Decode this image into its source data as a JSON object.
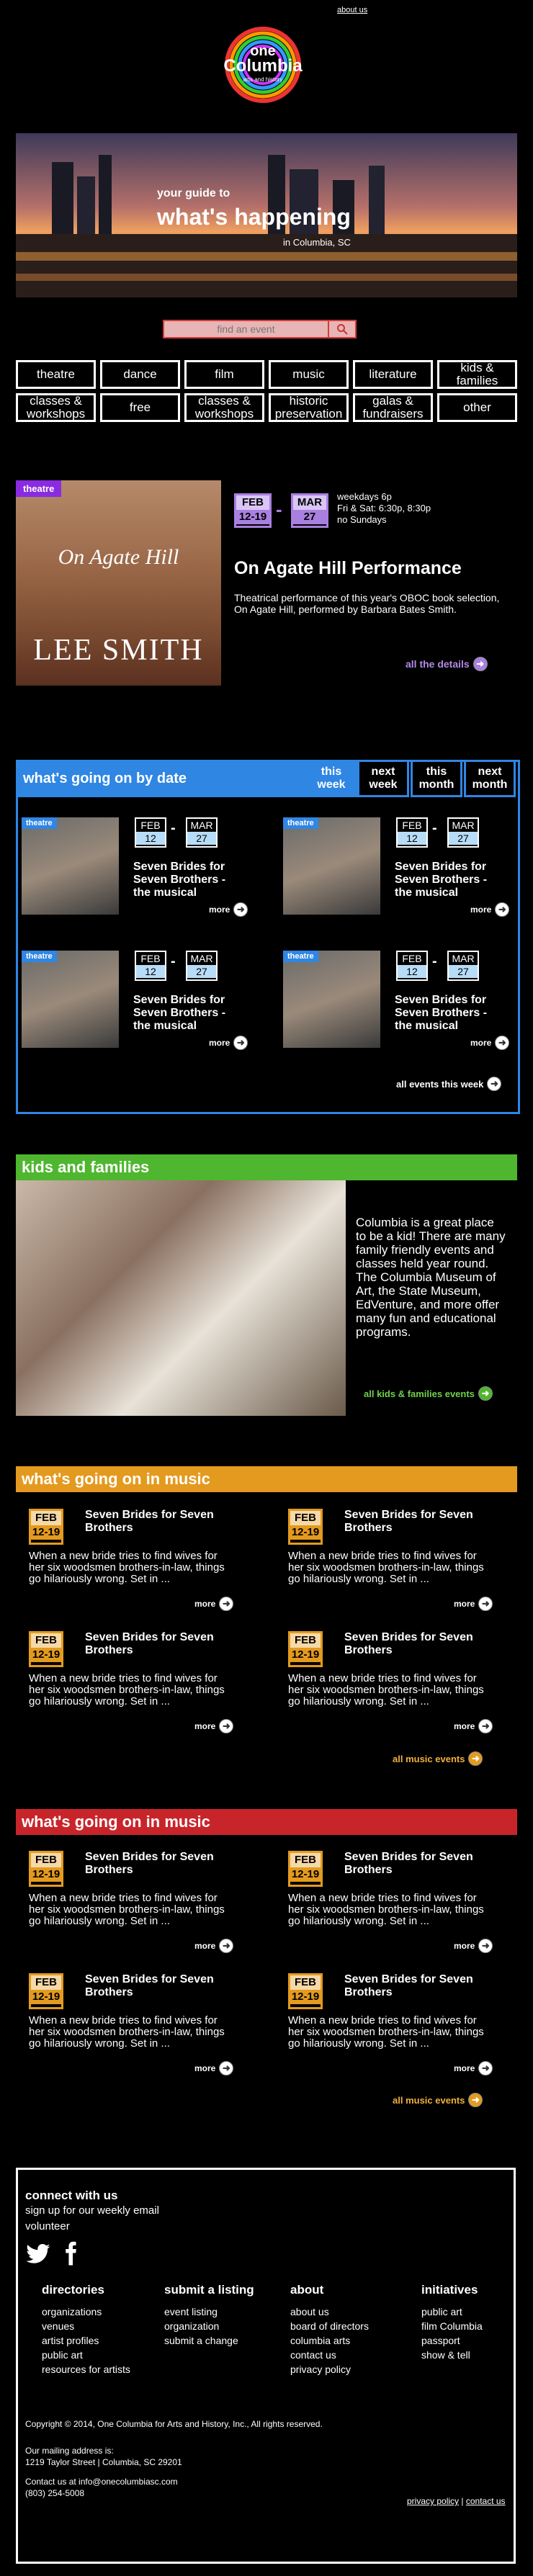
{
  "topnav": {
    "about": "about us"
  },
  "logo": {
    "line1": "one",
    "line2": "Columbia",
    "line3": "arts and history"
  },
  "hero": {
    "line1": "your guide to",
    "line2": "what's happening",
    "line3": "in Columbia, SC"
  },
  "search": {
    "placeholder": "find an event"
  },
  "categories": [
    "theatre",
    "dance",
    "film",
    "music",
    "literature",
    "kids & families",
    "classes & workshops",
    "free",
    "classes & workshops",
    "historic preservation",
    "galas & fundraisers",
    "other"
  ],
  "featured": {
    "tag": "theatre",
    "book_title": "On Agate Hill",
    "book_author": "LEE SMITH",
    "start_month": "FEB",
    "start_day": "12-19",
    "end_month": "MAR",
    "end_day": "27",
    "schedule": [
      "weekdays 6p",
      "Fri & Sat: 6:30p, 8:30p",
      "no Sundays"
    ],
    "title": "On Agate Hill Performance",
    "description": "Theatrical performance of this year's OBOC book selection, On Agate Hill, performed by Barbara Bates Smith.",
    "link": "all the details",
    "colors": {
      "tag": "#8a2be2",
      "date": "#a97fe0"
    }
  },
  "by_date": {
    "heading": "what's going on by date",
    "tabs": [
      "this week",
      "next week",
      "this month",
      "next month"
    ],
    "events": [
      {
        "tag": "theatre",
        "start_month": "FEB",
        "start_day": "12",
        "end_month": "MAR",
        "end_day": "27",
        "title": "Seven Brides for Seven Brothers - the musical",
        "more": "more"
      },
      {
        "tag": "theatre",
        "start_month": "FEB",
        "start_day": "12",
        "end_month": "MAR",
        "end_day": "27",
        "title": "Seven Brides for Seven Brothers - the musical",
        "more": "more"
      },
      {
        "tag": "theatre",
        "start_month": "FEB",
        "start_day": "12",
        "end_month": "MAR",
        "end_day": "27",
        "title": "Seven Brides for Seven Brothers - the musical",
        "more": "more"
      },
      {
        "tag": "theatre",
        "start_month": "FEB",
        "start_day": "12",
        "end_month": "MAR",
        "end_day": "27",
        "title": "Seven Brides for Seven Brothers - the musical",
        "more": "more"
      }
    ],
    "all_link": "all events this week",
    "color": "#2f86e3"
  },
  "kids": {
    "heading": "kids and families",
    "text": "Columbia is a great place to be a kid!  There are many family friendly events and classes held year round.  The Columbia Museum of Art, the State Museum, EdVenture, and more offer many fun and educational programs.",
    "link": "all kids & families events",
    "color": "#4fb62f"
  },
  "music1": {
    "heading": "what's going on in music",
    "color": "#e39a1e",
    "events": [
      {
        "month": "FEB",
        "day": "12-19",
        "title": "Seven Brides for Seven Brothers",
        "desc": "When a new bride tries to find wives for her six woodsmen brothers-in-law, things go hilariously wrong. Set in ...",
        "more": "more"
      },
      {
        "month": "FEB",
        "day": "12-19",
        "title": "Seven Brides for Seven Brothers",
        "desc": "When a new bride tries to find wives for her six woodsmen brothers-in-law, things go hilariously wrong. Set in ...",
        "more": "more"
      },
      {
        "month": "FEB",
        "day": "12-19",
        "title": "Seven Brides for Seven Brothers",
        "desc": "When a new bride tries to find wives for her six woodsmen brothers-in-law, things go hilariously wrong. Set in ...",
        "more": "more"
      },
      {
        "month": "FEB",
        "day": "12-19",
        "title": "Seven Brides for Seven Brothers",
        "desc": "When a new bride tries to find wives for her six woodsmen brothers-in-law, things go hilariously wrong. Set in ...",
        "more": "more"
      }
    ],
    "all_link": "all music events"
  },
  "music2": {
    "heading": "what's going on in music",
    "color": "#c8252b",
    "events": [
      {
        "month": "FEB",
        "day": "12-19",
        "title": "Seven Brides for Seven Brothers",
        "desc": "When a new bride tries to find wives for her six woodsmen brothers-in-law, things go hilariously wrong. Set in ...",
        "more": "more"
      },
      {
        "month": "FEB",
        "day": "12-19",
        "title": "Seven Brides for Seven Brothers",
        "desc": "When a new bride tries to find wives for her six woodsmen brothers-in-law, things go hilariously wrong. Set in ...",
        "more": "more"
      },
      {
        "month": "FEB",
        "day": "12-19",
        "title": "Seven Brides for Seven Brothers",
        "desc": "When a new bride tries to find wives for her six woodsmen brothers-in-law, things go hilariously wrong. Set in ...",
        "more": "more"
      },
      {
        "month": "FEB",
        "day": "12-19",
        "title": "Seven Brides for Seven Brothers",
        "desc": "When a new bride tries to find wives for her six woodsmen brothers-in-law, things go hilariously wrong. Set in ...",
        "more": "more"
      }
    ],
    "all_link": "all music events"
  },
  "footer": {
    "connect_heading": "connect with us",
    "signup": "sign up for our weekly email",
    "volunteer": "volunteer",
    "columns": [
      {
        "heading": "directories",
        "items": [
          "organizations",
          "venues",
          "artist profiles",
          "public art",
          "resources for artists"
        ]
      },
      {
        "heading": "submit a listing",
        "items": [
          "event listing",
          "organization",
          "submit a change"
        ]
      },
      {
        "heading": "about",
        "items": [
          "about us",
          "board of directors",
          "columbia arts",
          "contact us",
          "privacy policy"
        ]
      },
      {
        "heading": "initiatives",
        "items": [
          "public art",
          "film Columbia",
          "passport",
          "show & tell"
        ]
      }
    ],
    "copyright": "Copyright © 2014, One Columbia for Arts and History, Inc., All rights reserved.",
    "mailing_label": "Our mailing address is:",
    "address": "1219 Taylor Street | Columbia, SC 29201",
    "contact": "Contact us at info@onecolumbiasc.com",
    "phone": "(803) 254-5008",
    "privacy": "privacy policy",
    "contact_us": "contact us"
  }
}
